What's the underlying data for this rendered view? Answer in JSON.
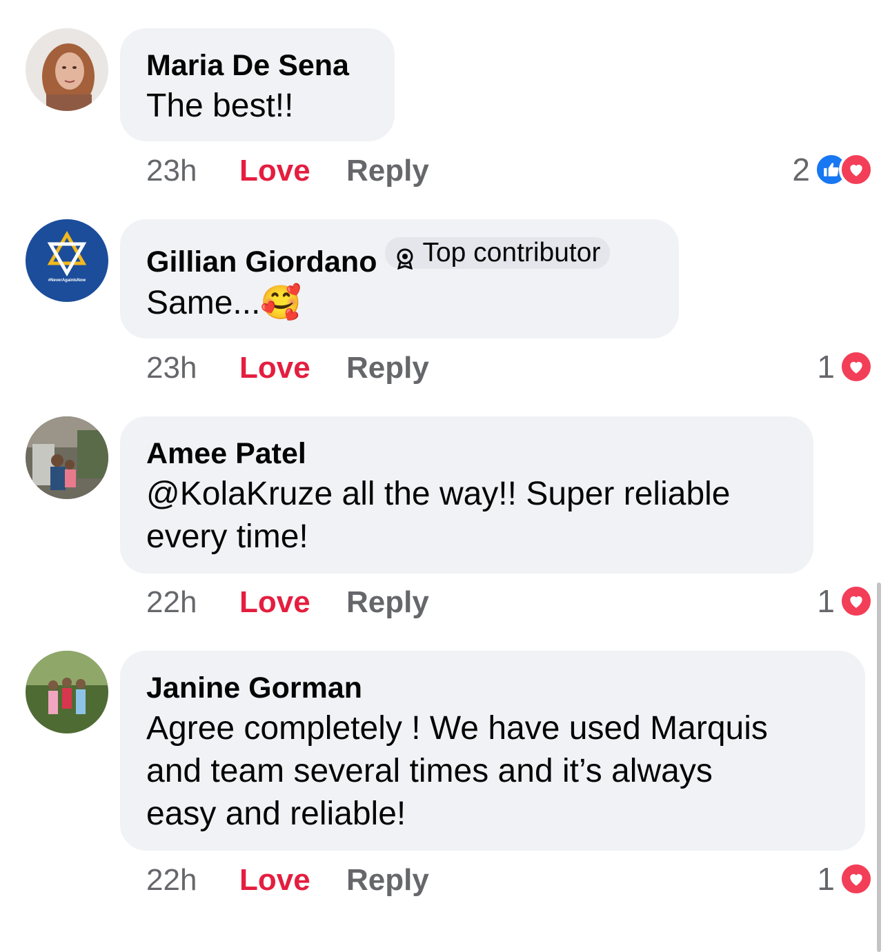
{
  "comments": [
    {
      "author": "Maria De Sena",
      "text": [
        "The best!!"
      ],
      "time": "23h",
      "love_label": "Love",
      "reply_label": "Reply",
      "reaction_count": "2",
      "reactions": [
        "like-icon",
        "love-icon"
      ]
    },
    {
      "author": "Gillian Giordano",
      "badge": "Top contributor",
      "text": [
        "Same..."
      ],
      "emoji": "🥰",
      "time": "23h",
      "love_label": "Love",
      "reply_label": "Reply",
      "reaction_count": "1",
      "reactions": [
        "love-icon"
      ],
      "avatar_text": "#NeverAgainIsNow"
    },
    {
      "author": "Amee Patel",
      "text": [
        "@KolaKruze all the way!! Super reliable",
        "every time!"
      ],
      "time": "22h",
      "love_label": "Love",
      "reply_label": "Reply",
      "reaction_count": "1",
      "reactions": [
        "love-icon"
      ]
    },
    {
      "author": "Janine Gorman",
      "text": [
        "Agree completely ! We have used Marquis",
        "and team several times and it’s always",
        "easy and reliable!"
      ],
      "time": "22h",
      "love_label": "Love",
      "reply_label": "Reply",
      "reaction_count": "1",
      "reactions": [
        "love-icon"
      ]
    }
  ],
  "colors": {
    "bubble": "#f0f2f5",
    "love_red": "#e41e3f",
    "meta_gray": "#65676b",
    "like_blue": "#1877f2",
    "heart_red": "#f33e58"
  }
}
